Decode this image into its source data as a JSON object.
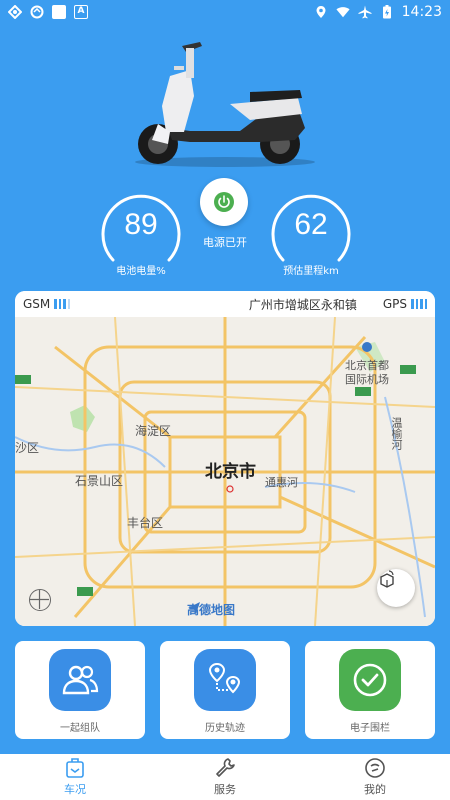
{
  "status_bar": {
    "time": "14:23"
  },
  "vehicle": {
    "battery_value": "89",
    "battery_label": "电池电量%",
    "power_label": "电源已开",
    "range_value": "62",
    "range_label": "预估里程km"
  },
  "map": {
    "gsm_label": "GSM",
    "gps_label": "GPS",
    "address": "广州市增城区永和镇",
    "city": "北京市",
    "districts": [
      "海淀区",
      "石景山区",
      "丰台区",
      "通惠河",
      "北京首都",
      "国际机场",
      "温榆河",
      "沙区"
    ],
    "provider": "高德地图"
  },
  "features": [
    {
      "label": "一起组队",
      "icon": "group-icon",
      "color": "#3a8ee6"
    },
    {
      "label": "历史轨迹",
      "icon": "route-icon",
      "color": "#3a8ee6"
    },
    {
      "label": "电子围栏",
      "icon": "checkmark-icon",
      "color": "#4caf50"
    }
  ],
  "nav": [
    {
      "label": "车况",
      "icon": "vehicle-status-icon",
      "active": true
    },
    {
      "label": "服务",
      "icon": "wrench-icon",
      "active": false
    },
    {
      "label": "我的",
      "icon": "profile-icon",
      "active": false
    }
  ],
  "colors": {
    "primary": "#3b9df0",
    "power_green": "#4caf50"
  }
}
